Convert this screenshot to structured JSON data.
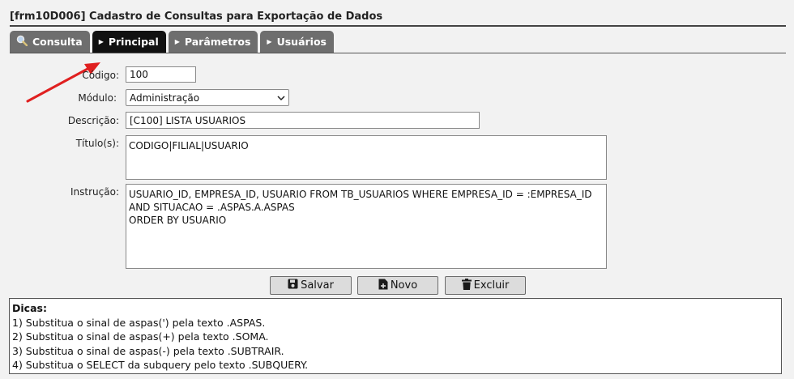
{
  "window": {
    "title": "[frm10D006] Cadastro de Consultas para Exportação de Dados"
  },
  "tabs": [
    {
      "label": "Consulta",
      "icon": "magnifier-icon",
      "active": false
    },
    {
      "label": "Principal",
      "icon": "chevron-right-icon",
      "active": true
    },
    {
      "label": "Parâmetros",
      "icon": "chevron-right-icon",
      "active": false
    },
    {
      "label": "Usuários",
      "icon": "chevron-right-icon",
      "active": false
    }
  ],
  "form": {
    "codigo_label": "Código:",
    "codigo_value": "100",
    "modulo_label": "Módulo:",
    "modulo_value": "Administração",
    "descricao_label": "Descrição:",
    "descricao_value": "[C100] LISTA USUARIOS",
    "titulos_label": "Título(s):",
    "titulos_value": "CODIGO|FILIAL|USUARIO",
    "instrucao_label": "Instrução:",
    "instrucao_value": "USUARIO_ID, EMPRESA_ID, USUARIO FROM TB_USUARIOS WHERE EMPRESA_ID = :EMPRESA_ID\nAND SITUACAO = .ASPAS.A.ASPAS\nORDER BY USUARIO"
  },
  "buttons": {
    "salvar": "Salvar",
    "novo": "Novo",
    "excluir": "Excluir"
  },
  "tips": {
    "heading": "Dicas:",
    "lines": [
      "1) Substitua o sinal de aspas(') pela texto .ASPAS.",
      "2) Substitua o sinal de aspas(+) pela texto .SOMA.",
      "3) Substitua o sinal de aspas(-) pela texto .SUBTRAIR.",
      "4) Substitua o SELECT da subquery pelo texto .SUBQUERY."
    ]
  },
  "colors": {
    "tab_active": "#111111",
    "tab_inactive": "#6e6e6e",
    "annotation_arrow": "#e02020"
  }
}
